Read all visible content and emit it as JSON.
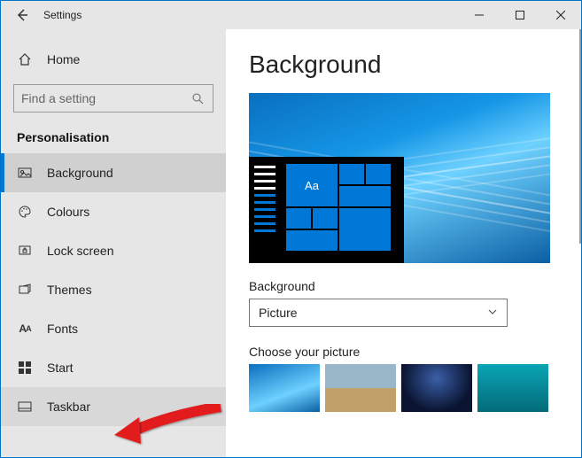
{
  "titlebar": {
    "title": "Settings"
  },
  "sidebar": {
    "home_label": "Home",
    "search_placeholder": "Find a setting",
    "section": "Personalisation",
    "items": [
      {
        "label": "Background"
      },
      {
        "label": "Colours"
      },
      {
        "label": "Lock screen"
      },
      {
        "label": "Themes"
      },
      {
        "label": "Fonts"
      },
      {
        "label": "Start"
      },
      {
        "label": "Taskbar"
      }
    ]
  },
  "main": {
    "heading": "Background",
    "preview_sample": "Aa",
    "bg_label": "Background",
    "bg_value": "Picture",
    "choose_label": "Choose your picture"
  }
}
